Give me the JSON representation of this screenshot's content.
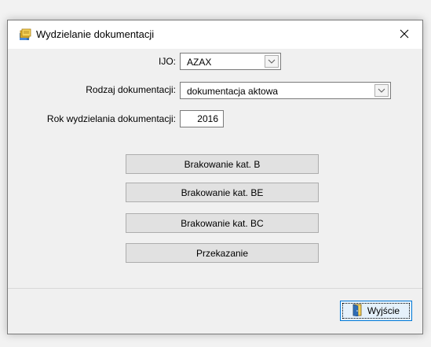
{
  "window": {
    "title": "Wydzielanie dokumentacji",
    "close_glyph": "✕"
  },
  "form": {
    "ijo_label": "IJO:",
    "ijo_value": "AZAX",
    "rodzaj_label": "Rodzaj dokumentacji:",
    "rodzaj_value": "dokumentacja aktowa",
    "rok_label": "Rok wydzielania dokumentacji:",
    "rok_value": "2016"
  },
  "buttons": {
    "brakowanie_b": "Brakowanie kat. B",
    "brakowanie_be": "Brakowanie kat. BE",
    "brakowanie_bc": "Brakowanie kat. BC",
    "przekazanie": "Przekazanie",
    "wyjscie": "Wyjście"
  },
  "icons": {
    "app": "document-stack-icon",
    "combo_arrow": "chevron-down-icon",
    "exit": "door-exit-icon",
    "close": "close-icon"
  },
  "colors": {
    "focus_accent": "#0078d7",
    "button_face": "#e1e1e1"
  }
}
